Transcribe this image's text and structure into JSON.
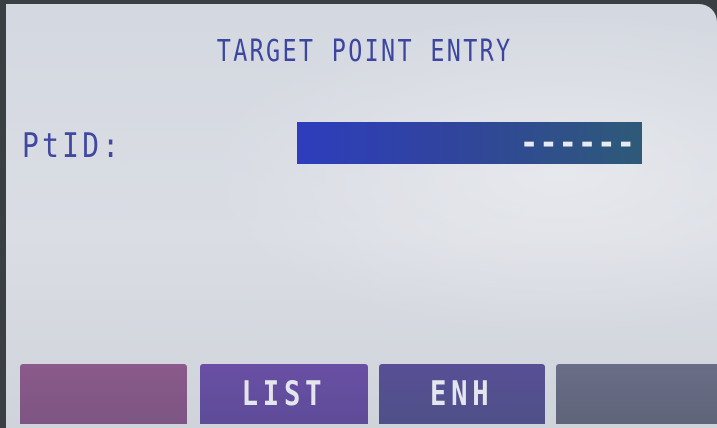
{
  "screen": {
    "title": "TARGET POINT ENTRY"
  },
  "form": {
    "ptid_label": "PtID:",
    "ptid_value": "------"
  },
  "softkeys": [
    {
      "label": ""
    },
    {
      "label": "LIST"
    },
    {
      "label": "ENH"
    },
    {
      "label": ""
    }
  ],
  "colors": {
    "title_text": "#3c46a0",
    "input_background": "#2e3dbd",
    "screen_background": "#d6dae1"
  }
}
